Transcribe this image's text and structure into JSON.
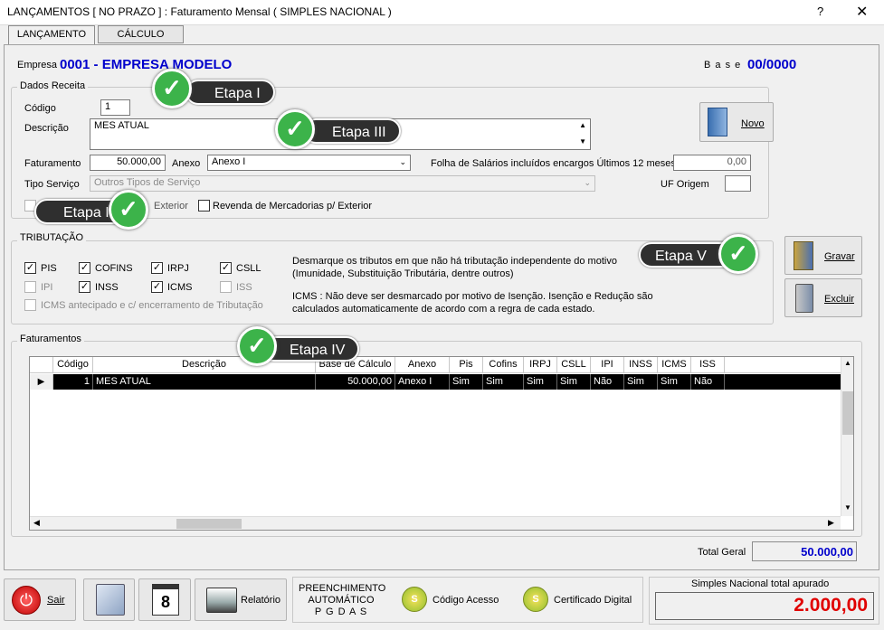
{
  "window": {
    "title": "LANÇAMENTOS [ NO PRAZO ] : Faturamento Mensal ( SIMPLES NACIONAL )",
    "help": "?",
    "close": "✕"
  },
  "tabs": [
    {
      "label": "LANÇAMENTO"
    },
    {
      "label": "CÁLCULO"
    }
  ],
  "header": {
    "empresa_label": "Empresa",
    "empresa_value": "0001 - EMPRESA MODELO",
    "base_label": "B a s e",
    "base_value": "00/0000"
  },
  "dados_receita": {
    "group_label": "Dados Receita",
    "codigo_label": "Código",
    "codigo_value": "1",
    "descricao_label": "Descrição",
    "descricao_value": "MES ATUAL",
    "faturamento_label": "Faturamento",
    "faturamento_value": "50.000,00",
    "anexo_label": "Anexo",
    "anexo_value": "Anexo I",
    "folha_label": "Folha de Salários incluídos encargos Últimos 12 meses",
    "folha_value": "0,00",
    "tipo_servico_label": "Tipo Serviço",
    "tipo_servico_value": "Outros Tipos de Serviço",
    "uf_origem_label": "UF Origem",
    "uf_origem_value": "",
    "exterior_label": "Exterior",
    "revenda_label": "Revenda de Mercadorias p/ Exterior",
    "novo_label": "Novo"
  },
  "tributacao": {
    "group_label": "TRIBUTAÇÃO",
    "items": [
      {
        "label": "PIS",
        "checked": true,
        "enabled": true
      },
      {
        "label": "COFINS",
        "checked": true,
        "enabled": true
      },
      {
        "label": "IRPJ",
        "checked": true,
        "enabled": true
      },
      {
        "label": "CSLL",
        "checked": true,
        "enabled": true
      },
      {
        "label": "IPI",
        "checked": false,
        "enabled": false
      },
      {
        "label": "INSS",
        "checked": true,
        "enabled": true
      },
      {
        "label": "ICMS",
        "checked": true,
        "enabled": true
      },
      {
        "label": "ISS",
        "checked": false,
        "enabled": false
      }
    ],
    "icms_antecipado_label": "ICMS antecipado e c/ encerramento de Tributação",
    "note1": "Desmarque os tributos em que não há tributação independente do motivo (Imunidade, Substituição Tributária, dentre outros)",
    "note2": "ICMS : Não deve ser desmarcado por motivo de Isenção. Isenção e Redução são calculados automaticamente de acordo com a regra de cada estado.",
    "gravar_label": "Gravar",
    "excluir_label": "Excluir"
  },
  "faturamentos": {
    "group_label": "Faturamentos",
    "columns": [
      "Código",
      "Descrição",
      "Base de Cálculo",
      "Anexo",
      "Pis",
      "Cofins",
      "IRPJ",
      "CSLL",
      "IPI",
      "INSS",
      "ICMS",
      "ISS"
    ],
    "rows": [
      [
        "1",
        "MES ATUAL",
        "50.000,00",
        "Anexo I",
        "Sim",
        "Sim",
        "Sim",
        "Sim",
        "Não",
        "Sim",
        "Sim",
        "Não"
      ]
    ],
    "total_label": "Total Geral",
    "total_value": "50.000,00"
  },
  "callouts": {
    "etapa1": "Etapa I",
    "etapa2": "Etapa II",
    "etapa3": "Etapa III",
    "etapa4": "Etapa IV",
    "etapa5": "Etapa V"
  },
  "footer": {
    "sair_label": "Sair",
    "calendar_day": "8",
    "relatorio_label": "Relatório",
    "preenchimento_line1": "PREENCHIMENTO",
    "preenchimento_line2": "AUTOMÁTICO",
    "preenchimento_line3": "P G D A S",
    "codigo_acesso_label": "Código Acesso",
    "certificado_label": "Certificado Digital",
    "simples_label": "Simples  Nacional  total  apurado",
    "simples_value": "2.000,00"
  },
  "colors": {
    "brand_blue": "#0000cc",
    "total_red": "#e00000",
    "check_green": "#3cb34a",
    "callout_dark": "#2f2f2f"
  }
}
